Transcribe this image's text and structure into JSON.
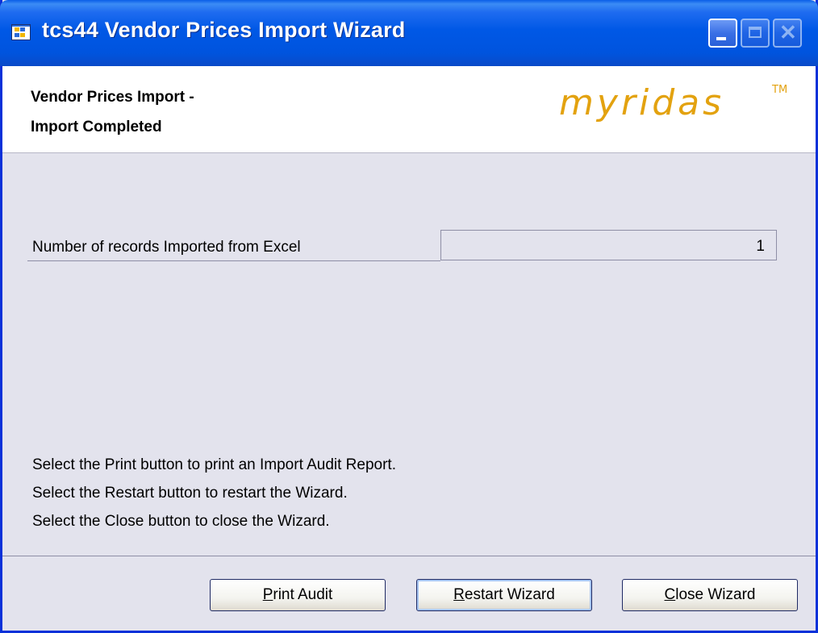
{
  "window": {
    "title": "tcs44 Vendor Prices Import Wizard"
  },
  "header": {
    "title_line1": "Vendor Prices Import -",
    "title_line2": "Import Completed",
    "logo_text": "myridas",
    "logo_tm": "TM"
  },
  "records": {
    "label": "Number of records Imported from Excel",
    "value": "1"
  },
  "instructions": [
    "Select the Print button to print an Import Audit Report.",
    "Select the Restart button to restart the Wizard.",
    "Select the Close button to close the Wizard."
  ],
  "buttons": {
    "print_mnemonic": "P",
    "print_rest": "rint Audit",
    "restart_mnemonic": "R",
    "restart_rest": "estart Wizard",
    "close_mnemonic": "C",
    "close_rest": "lose Wizard"
  },
  "icons": {
    "app": "wizard-app-icon",
    "minimize": "minimize-icon",
    "maximize": "maximize-icon",
    "close": "close-icon"
  },
  "colors": {
    "titlebar": "#0054de",
    "logo": "#e3a20f",
    "body_bg": "#e3e3ed"
  }
}
